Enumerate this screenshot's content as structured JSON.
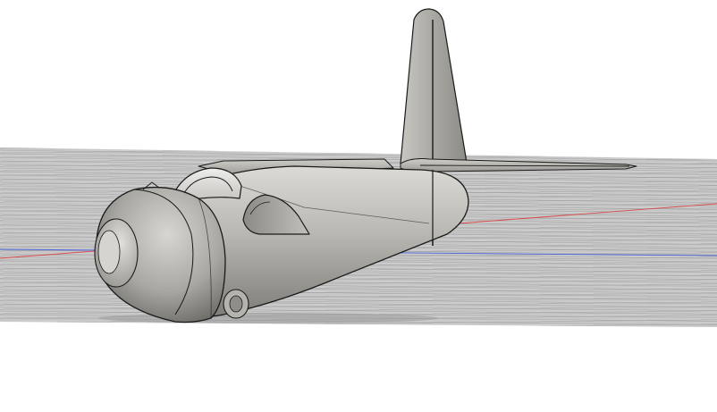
{
  "viewport": {
    "background": "#ffffff",
    "ground_plane_color": "#c9c9c9",
    "ground_line_color": "#9a9a9a",
    "x_axis_color": "#d94b4b",
    "y_axis_color": "#4b5fd9"
  },
  "model": {
    "body_color": "#a8a6a1",
    "body_light": "#d3d1cc",
    "body_dark": "#7c7a75",
    "edge_color": "#1a1a1a",
    "shadow_color": "#9a9a9a"
  }
}
